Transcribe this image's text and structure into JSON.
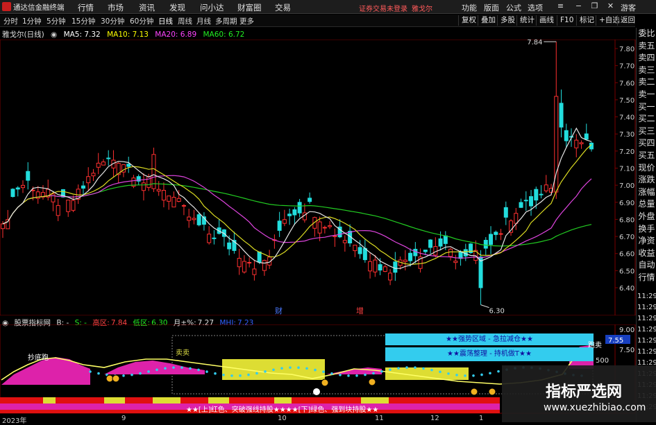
{
  "titlebar": {
    "app_name": "通达信金融终端",
    "menus": [
      "行情",
      "市场",
      "资讯",
      "发现",
      "问小达",
      "财富圈",
      "交易"
    ],
    "login_notice": "证券交易未登录",
    "stock_name": "雅戈尔",
    "right_menus": [
      "功能",
      "版面",
      "公式",
      "选项",
      "游客"
    ]
  },
  "toolbar": {
    "periods": [
      "分时",
      "1分钟",
      "5分钟",
      "15分钟",
      "30分钟",
      "60分钟",
      "日线",
      "周线",
      "月线",
      "多周期",
      "更多"
    ],
    "active_period": "日线",
    "right_buttons": [
      "复权",
      "叠加",
      "多股",
      "统计",
      "画线",
      "F10",
      "标记",
      "+自选",
      "返回"
    ]
  },
  "info": {
    "title": "雅戈尔(日线)",
    "ma5": "MA5: 7.32",
    "ma10": "MA10: 7.13",
    "ma20": "MA20: 6.89",
    "ma60": "MA60: 6.72",
    "colors": {
      "title": "#e0e0e0",
      "ma5": "#ffffff",
      "ma10": "#ffff00",
      "ma20": "#ff44ff",
      "ma60": "#22ee22"
    }
  },
  "side_tabs": [
    "委比",
    "卖五",
    "卖四",
    "卖三",
    "卖二",
    "卖一",
    "买一",
    "买二",
    "买三",
    "买四",
    "买五",
    "现价",
    "涨跌",
    "涨幅",
    "总量",
    "外盘",
    "换手",
    "净资",
    "收益",
    "自动",
    "行情"
  ],
  "side_times": [
    "11:29",
    "11:29",
    "11:29",
    "11:29",
    "11:29",
    "11:29",
    "11:29",
    "11:29",
    "11:29",
    "11:29",
    "11:29"
  ],
  "chart_data": {
    "type": "candlestick",
    "price_axis": [
      "7.80",
      "7.70",
      "7.60",
      "7.50",
      "7.40",
      "7.30",
      "7.20",
      "7.10",
      "7.00",
      "6.90",
      "6.80",
      "6.70",
      "6.60",
      "6.50",
      "6.40"
    ],
    "high_label": "7.84",
    "low_label": "6.30",
    "event_labels": [
      "财",
      "增"
    ],
    "ma_series": [
      "MA5",
      "MA10",
      "MA20",
      "MA60"
    ],
    "date_labels": [
      "2023年",
      "9",
      "10",
      "11",
      "12",
      "1"
    ]
  },
  "sub": {
    "title": "股票指标网",
    "b_label": "B: -",
    "s_label": "S: -",
    "high_area_label": "高区:",
    "high_area_val": "7.84",
    "low_area_label": "低区:",
    "low_area_val": "6.30",
    "month_label": "月±%:",
    "month_val": "7.27",
    "mhi_label": "MHI:",
    "mhi_val": "7.23",
    "axis_labels": [
      "9.00",
      "7.55",
      "7.50"
    ],
    "current_tag": "7.55",
    "signals": [
      "抄底跑",
      "卖卖",
      "跑卖"
    ],
    "box_lines": [
      "★★强势区域 - 急拉减仓★★",
      "★★震荡整理 - 持机做T★★"
    ],
    "bottom_text": "★★[上]红色、突破强线持股★★★★[下]绿色、强到块持股★★",
    "side_badge": "500"
  },
  "watermark": {
    "title": "指标严选网",
    "url": "www.xuezhibiao.com"
  }
}
